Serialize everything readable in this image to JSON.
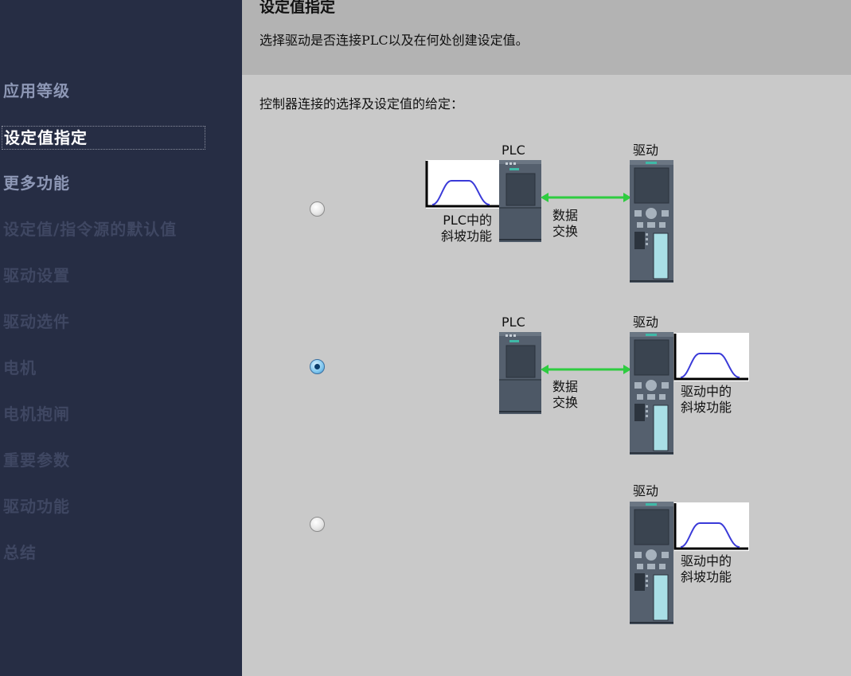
{
  "sidebar": {
    "items": [
      {
        "label": "应用等级",
        "state": "done"
      },
      {
        "label": "设定值指定",
        "state": "active"
      },
      {
        "label": "更多功能",
        "state": "done"
      },
      {
        "label": "设定值/指令源的默认值",
        "state": "todo"
      },
      {
        "label": "驱动设置",
        "state": "todo"
      },
      {
        "label": "驱动选件",
        "state": "todo"
      },
      {
        "label": "电机",
        "state": "todo"
      },
      {
        "label": "电机抱闸",
        "state": "todo"
      },
      {
        "label": "重要参数",
        "state": "todo"
      },
      {
        "label": "驱动功能",
        "state": "todo"
      },
      {
        "label": "总结",
        "state": "todo"
      }
    ]
  },
  "header": {
    "title": "设定值指定",
    "subtitle": "选择驱动是否连接PLC以及在何处创建设定值。"
  },
  "content": {
    "prompt": "控制器连接的选择及设定值的给定：",
    "options": [
      {
        "selected": false,
        "plc_label": "PLC",
        "drive_label": "驱动",
        "exchange_line1": "数据",
        "exchange_line2": "交换",
        "ramp_line1": "PLC中的",
        "ramp_line2": "斜坡功能"
      },
      {
        "selected": true,
        "plc_label": "PLC",
        "drive_label": "驱动",
        "exchange_line1": "数据",
        "exchange_line2": "交换",
        "ramp_line1": "驱动中的",
        "ramp_line2": "斜坡功能"
      },
      {
        "selected": false,
        "drive_label": "驱动",
        "ramp_line1": "驱动中的",
        "ramp_line2": "斜坡功能"
      }
    ]
  },
  "colors": {
    "sidebar_bg": "#262d44",
    "header_bg": "#b3b3b3",
    "content_bg": "#c9c9c9",
    "arrow": "#2ecc40",
    "ramp_curve": "#3a3ad8"
  }
}
